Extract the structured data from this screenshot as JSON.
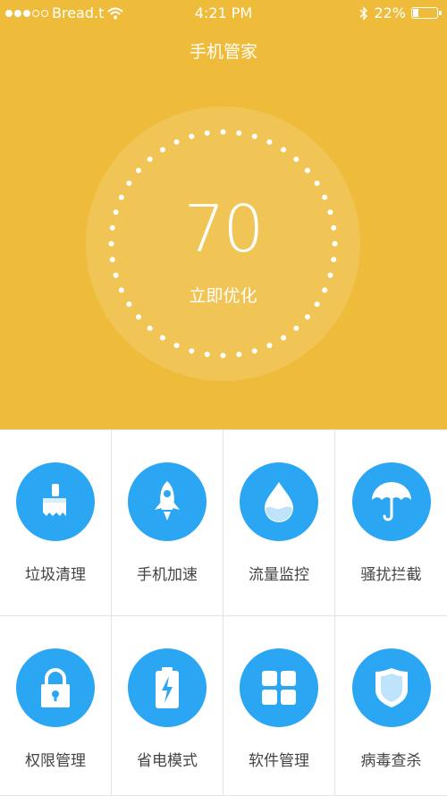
{
  "status_bar": {
    "carrier": "Bread.t",
    "time": "4:21 PM",
    "battery": "22%",
    "battery_level": 0.22,
    "signal_bars_filled": 3,
    "signal_bars_total": 5
  },
  "header": {
    "title": "手机管家"
  },
  "score": {
    "value": "70",
    "action_label": "立即优化"
  },
  "colors": {
    "hero": "#eebc3a",
    "icon_circle": "#2aa6f3",
    "label": "#444444"
  },
  "tools": [
    {
      "label": "垃圾清理",
      "icon": "broom-icon"
    },
    {
      "label": "手机加速",
      "icon": "rocket-icon"
    },
    {
      "label": "流量监控",
      "icon": "water-drop-icon"
    },
    {
      "label": "骚扰拦截",
      "icon": "umbrella-icon"
    },
    {
      "label": "权限管理",
      "icon": "lock-icon"
    },
    {
      "label": "省电模式",
      "icon": "battery-bolt-icon"
    },
    {
      "label": "软件管理",
      "icon": "app-grid-icon"
    },
    {
      "label": "病毒查杀",
      "icon": "shield-icon"
    }
  ]
}
